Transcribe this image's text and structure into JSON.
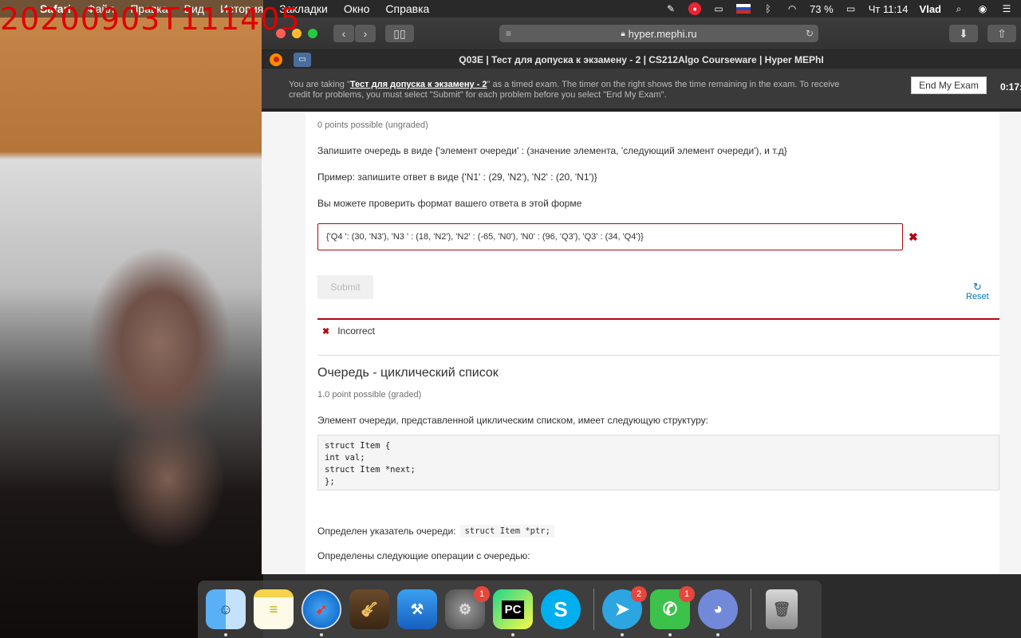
{
  "overlay_timestamp": "20200903T111405",
  "menubar": {
    "apple": "",
    "app": "Safari",
    "items": [
      "Файл",
      "Правка",
      "Вид",
      "История",
      "Закладки",
      "Окно",
      "Справка"
    ],
    "battery": "73 %",
    "clock": "Чт 11:14",
    "user": "Vlad"
  },
  "browser": {
    "url": "hyper.mephi.ru",
    "tab_title": "Q03E | Тест для допуска к экзамену - 2 | CS212Algo Courseware | Hyper MEPhI"
  },
  "exam_banner": {
    "prefix": "You are taking \"",
    "exam_name": "Тест для допуска к экзамену - 2",
    "suffix": "\" as a timed exam. The timer on the right shows the time remaining in the exam. To receive credit for problems, you must select \"Submit\" for each problem before you select \"End My Exam\".",
    "end_button": "End My Exam",
    "timer": "0:17:"
  },
  "problem1": {
    "points": "0 points possible (ungraded)",
    "instruction": "Запишите очередь в виде {'элемент очереди' : (значение элемента, 'следующий элемент очереди'), и т.д}",
    "example": "Пример: запишите ответ в виде {'N1' : (29, 'N2'), 'N2' : (20, 'N1')}",
    "hint": "Вы можете проверить формат вашего ответа в этой форме",
    "answer_value": "{'Q4 ': (30, 'N3'), 'N3 ' : (18, 'N2'), 'N2' : (-65, 'N0'), 'N0' : (96, 'Q3'), 'Q3' : (34, 'Q4')}",
    "submit": "Submit",
    "reset": "Reset",
    "status": "Incorrect"
  },
  "problem2": {
    "title": "Очередь - циклический список",
    "points": "1.0 point possible (graded)",
    "description": "Элемент очереди, представленной циклическим списком, имеет следующую структуру:",
    "code": "struct Item {\nint val;\nstruct Item *next;\n};",
    "pointer_text": "Определен указатель очереди:",
    "pointer_code": "struct Item *ptr;",
    "operations_text": "Определены следующие операции с очередью:"
  },
  "dock": {
    "apps": [
      {
        "name": "Finder",
        "badge": ""
      },
      {
        "name": "Notes",
        "badge": ""
      },
      {
        "name": "Safari",
        "badge": ""
      },
      {
        "name": "GarageBand",
        "badge": ""
      },
      {
        "name": "Xcode",
        "badge": ""
      },
      {
        "name": "System Preferences",
        "badge": "1"
      },
      {
        "name": "PyCharm",
        "badge": ""
      },
      {
        "name": "Skype",
        "badge": ""
      },
      {
        "name": "Telegram",
        "badge": "2"
      },
      {
        "name": "FaceTime",
        "badge": "1"
      },
      {
        "name": "Discord",
        "badge": ""
      },
      {
        "name": "Trash",
        "badge": ""
      }
    ]
  },
  "colors": {
    "error_red": "#b20610",
    "link_blue": "#0075b4",
    "timestamp_red": "#e00000"
  }
}
